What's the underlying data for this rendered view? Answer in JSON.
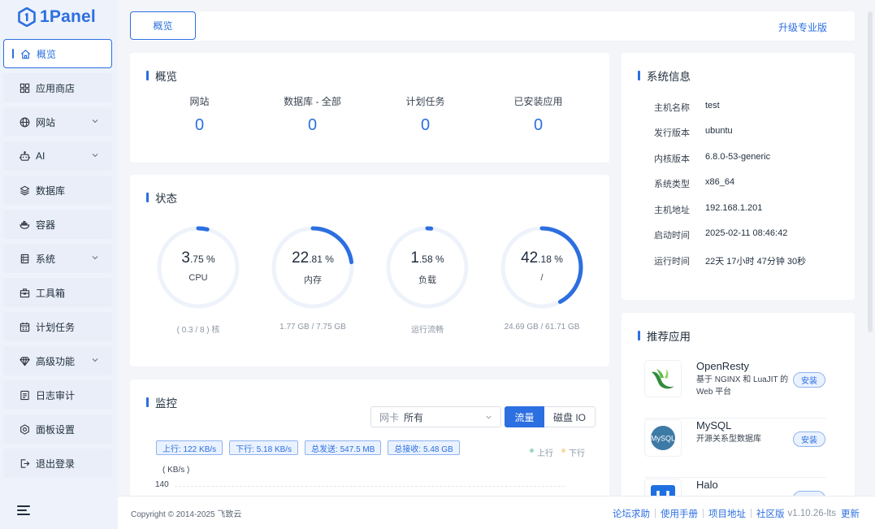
{
  "brand": {
    "name": "1Panel"
  },
  "sidebar": {
    "items": [
      {
        "label": "概览",
        "icon": "home-icon",
        "active": true,
        "expandable": false
      },
      {
        "label": "应用商店",
        "icon": "grid-icon",
        "expandable": false
      },
      {
        "label": "网站",
        "icon": "globe-icon",
        "expandable": true
      },
      {
        "label": "AI",
        "icon": "robot-icon",
        "expandable": true
      },
      {
        "label": "数据库",
        "icon": "layers-icon",
        "expandable": false
      },
      {
        "label": "容器",
        "icon": "whale-icon",
        "expandable": false
      },
      {
        "label": "系统",
        "icon": "server-icon",
        "expandable": true
      },
      {
        "label": "工具箱",
        "icon": "toolbox-icon",
        "expandable": false
      },
      {
        "label": "计划任务",
        "icon": "calendar-icon",
        "expandable": false
      },
      {
        "label": "高级功能",
        "icon": "diamond-icon",
        "expandable": true
      },
      {
        "label": "日志审计",
        "icon": "log-icon",
        "expandable": false
      },
      {
        "label": "面板设置",
        "icon": "settings-icon",
        "expandable": false
      },
      {
        "label": "退出登录",
        "icon": "logout-icon",
        "expandable": false
      }
    ]
  },
  "topbar": {
    "tab": "概览",
    "upgrade": "升级专业版"
  },
  "overview": {
    "title": "概览",
    "items": [
      {
        "label": "网站",
        "value": "0"
      },
      {
        "label": "数据库 - 全部",
        "value": "0"
      },
      {
        "label": "计划任务",
        "value": "0"
      },
      {
        "label": "已安装应用",
        "value": "0"
      }
    ]
  },
  "status": {
    "title": "状态",
    "gauges": [
      {
        "big": "3",
        "small": ".75 %",
        "label": "CPU",
        "sub": "( 0.3 / 8 ) 核",
        "percent": 3.75
      },
      {
        "big": "22",
        "small": ".81 %",
        "label": "内存",
        "sub": "1.77 GB / 7.75 GB",
        "percent": 22.81
      },
      {
        "big": "1",
        "small": ".58 %",
        "label": "负载",
        "sub": "运行流畅",
        "percent": 1.58
      },
      {
        "big": "42",
        "small": ".18 %",
        "label": "/",
        "sub": "24.69 GB / 61.71 GB",
        "percent": 42.18
      }
    ],
    "track_color": "#eef3fb",
    "fill_color": "#2c6fe0"
  },
  "monitor": {
    "title": "监控",
    "nic_label": "网卡",
    "nic_value": "所有",
    "seg_on": "流量",
    "seg_off": "磁盘 IO",
    "tags": [
      "上行: 122 KB/s",
      "下行: 5.18 KB/s",
      "总发送: 547.5 MB",
      "总接收: 5.48 GB"
    ],
    "legend": [
      {
        "label": "上行",
        "color": "#9fd6c2"
      },
      {
        "label": "下行",
        "color": "#f6dba0"
      }
    ],
    "unit": "( KB/s )",
    "ytick": "140"
  },
  "sysinfo": {
    "title": "系统信息",
    "rows": [
      {
        "k": "主机名称",
        "v": "test"
      },
      {
        "k": "发行版本",
        "v": "ubuntu"
      },
      {
        "k": "内核版本",
        "v": "6.8.0-53-generic"
      },
      {
        "k": "系统类型",
        "v": "x86_64"
      },
      {
        "k": "主机地址",
        "v": "192.168.1.201"
      },
      {
        "k": "启动时间",
        "v": "2025-02-11 08:46:42"
      },
      {
        "k": "运行时间",
        "v": "22天 17小时 47分钟 30秒"
      }
    ]
  },
  "recommend": {
    "title": "推荐应用",
    "apps": [
      {
        "name": "OpenResty",
        "desc": "基于 NGINX 和 LuaJIT 的 Web 平台",
        "button": "安装",
        "icon": "openresty-icon"
      },
      {
        "name": "MySQL",
        "desc": "开源关系型数据库",
        "button": "安装",
        "icon": "mysql-icon"
      },
      {
        "name": "Halo",
        "desc": "",
        "button": "",
        "icon": "halo-icon"
      }
    ]
  },
  "footer": {
    "copyright": "Copyright © 2014-2025 飞致云",
    "links": [
      "论坛求助",
      "使用手册",
      "项目地址"
    ],
    "edition": "社区版",
    "version": "v1.10.26-lts",
    "update": "更新"
  }
}
